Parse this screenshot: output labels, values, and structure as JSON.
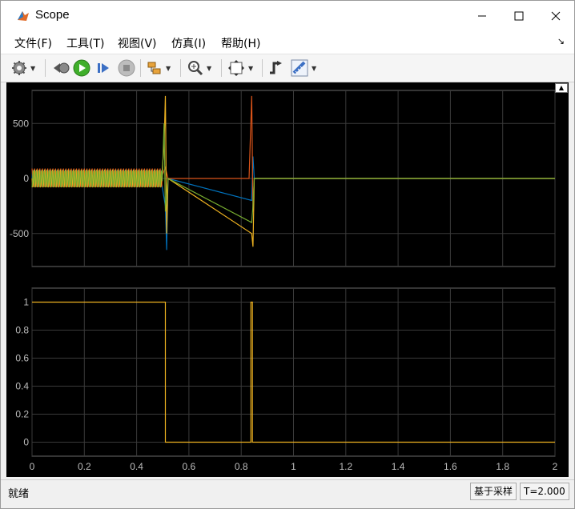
{
  "window": {
    "title": "Scope"
  },
  "menu": {
    "items": [
      "文件(F)",
      "工具(T)",
      "视图(V)",
      "仿真(I)",
      "帮助(H)"
    ]
  },
  "toolbar": {
    "icons": [
      "gear-icon",
      "step-back-icon",
      "run-icon",
      "step-forward-icon",
      "stop-icon",
      "highlight-block-icon",
      "zoom-icon",
      "autoscale-icon",
      "triggers-icon",
      "cursor-measurements-icon"
    ]
  },
  "status": {
    "text": "就绪",
    "sample_label": "基于采样",
    "time": "T=2.000"
  },
  "colors": {
    "background": "#000000",
    "grid": "#3a3a3a",
    "series": [
      "#0072bd",
      "#d95319",
      "#edb120",
      "#77ac30"
    ]
  },
  "chart_data": [
    {
      "type": "line",
      "title": "",
      "xlabel": "",
      "ylabel": "",
      "xlim": [
        0,
        2
      ],
      "ylim": [
        -800,
        800
      ],
      "yticks": [
        "500",
        "0",
        "-500"
      ],
      "ytick_values": [
        500,
        0,
        -500
      ],
      "grid": true,
      "series": [
        {
          "values": [
            [
              0,
              80
            ],
            [
              0.5,
              80
            ],
            [
              0.51,
              -250
            ],
            [
              0.515,
              -650
            ],
            [
              0.52,
              0
            ],
            [
              0.84,
              -200
            ],
            [
              0.845,
              200
            ],
            [
              0.85,
              0
            ],
            [
              2,
              0
            ]
          ]
        },
        {
          "values": [
            [
              0,
              -90
            ],
            [
              0.5,
              90
            ],
            [
              0.51,
              100
            ],
            [
              0.52,
              0
            ],
            [
              0.83,
              0
            ],
            [
              0.84,
              750
            ],
            [
              0.845,
              -300
            ],
            [
              0.85,
              0
            ],
            [
              2,
              0
            ]
          ]
        },
        {
          "values": [
            [
              0,
              85
            ],
            [
              0.5,
              85
            ],
            [
              0.505,
              300
            ],
            [
              0.51,
              750
            ],
            [
              0.515,
              -500
            ],
            [
              0.52,
              0
            ],
            [
              0.84,
              -500
            ],
            [
              0.845,
              -620
            ],
            [
              0.85,
              0
            ],
            [
              2,
              0
            ]
          ]
        },
        {
          "values": [
            [
              0,
              -80
            ],
            [
              0.5,
              -80
            ],
            [
              0.505,
              500
            ],
            [
              0.51,
              -300
            ],
            [
              0.52,
              0
            ],
            [
              0.84,
              -400
            ],
            [
              0.845,
              -250
            ],
            [
              0.85,
              0
            ],
            [
              2,
              0
            ]
          ]
        }
      ]
    },
    {
      "type": "line",
      "title": "",
      "xlabel": "",
      "ylabel": "",
      "xlim": [
        0,
        2
      ],
      "ylim": [
        -0.1,
        1.1
      ],
      "xticks": [
        "0",
        "0.2",
        "0.4",
        "0.6",
        "0.8",
        "1",
        "1.2",
        "1.4",
        "1.6",
        "1.8",
        "2"
      ],
      "xtick_values": [
        0,
        0.2,
        0.4,
        0.6,
        0.8,
        1,
        1.2,
        1.4,
        1.6,
        1.8,
        2
      ],
      "yticks": [
        "1",
        "0.8",
        "0.6",
        "0.4",
        "0.2",
        "0"
      ],
      "ytick_values": [
        1,
        0.8,
        0.6,
        0.4,
        0.2,
        0
      ],
      "grid": true,
      "series": [
        {
          "values": [
            [
              0,
              1
            ],
            [
              0.51,
              1
            ],
            [
              0.51,
              0
            ],
            [
              0.837,
              0
            ],
            [
              0.837,
              1
            ],
            [
              0.843,
              1
            ],
            [
              0.843,
              0
            ],
            [
              2,
              0
            ]
          ]
        }
      ]
    }
  ]
}
